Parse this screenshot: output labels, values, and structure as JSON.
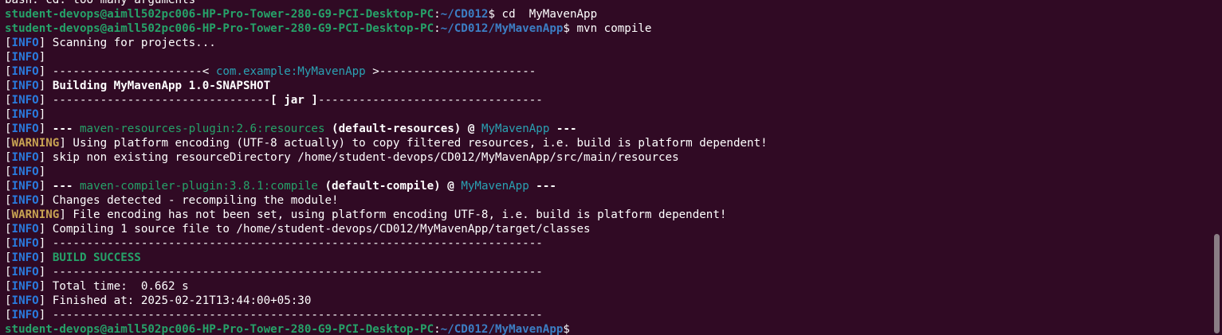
{
  "prompt": {
    "user_host": "student-devops@aimll502pc006-HP-Pro-Tower-280-G9-PCI-Desktop-PC",
    "colon": ":",
    "path_cd": "~/CD012",
    "path_project": "~/CD012/MyMavenApp",
    "dollar": "$"
  },
  "prev_output": "bash: cd: too many arguments",
  "commands": {
    "cd": " cd  MyMavenApp",
    "mvn": " mvn compile"
  },
  "tags": {
    "info": "INFO",
    "warning": "WARNING",
    "open": "[",
    "close": "]"
  },
  "output": {
    "scanning": " Scanning for projects...",
    "artifact_prefix": " ----------------------< ",
    "artifact_id": "com.example:MyMavenApp",
    "artifact_suffix": " >-----------------------",
    "building": "Building MyMavenApp 1.0-SNAPSHOT",
    "jar_prefix": " --------------------------------",
    "jar_label": "[ jar ]",
    "jar_suffix": "---------------------------------",
    "dashes": " ---",
    "resources_plugin": "maven-resources-plugin:2.6:resources",
    "resources_exec": "(default-resources)",
    "at": " @ ",
    "project": "MyMavenApp",
    "warn_encoding": " Using platform encoding (UTF-8 actually) to copy filtered resources, i.e. build is platform dependent!",
    "skip_resources": " skip non existing resourceDirectory /home/student-devops/CD012/MyMavenApp/src/main/resources",
    "compiler_plugin": "maven-compiler-plugin:3.8.1:compile",
    "compile_exec": "(default-compile)",
    "changes_detected": " Changes detected - recompiling the module!",
    "warn_file_encoding": " File encoding has not been set, using platform encoding UTF-8, i.e. build is platform dependent!",
    "compiling": " Compiling 1 source file to /home/student-devops/CD012/MyMavenApp/target/classes",
    "separator": " ------------------------------------------------------------------------",
    "build_success": "BUILD SUCCESS",
    "total_time": " Total time:  0.662 s",
    "finished_at": " Finished at: 2025-02-21T13:44:00+05:30"
  },
  "colors": {
    "background": "#300a24",
    "prompt_green": "#26a269",
    "prompt_blue": "#3c7ec4",
    "info_blue": "#2a7bde",
    "cyan": "#2aa1b3",
    "warning_yellow": "#c7a252"
  }
}
